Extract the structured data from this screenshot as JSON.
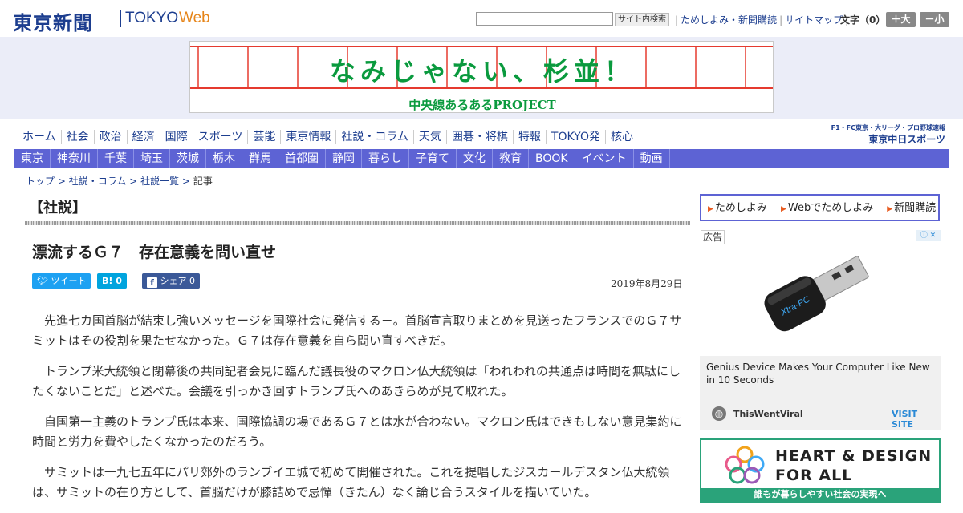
{
  "header": {
    "logo_main": "東京新聞",
    "logo_tokyo": "TOKYO",
    "logo_web": "Web",
    "search_button": "サイト内検索",
    "links": [
      "ためしよみ・新聞購読",
      "サイトマップ"
    ],
    "font_size_label": "文字（0）",
    "font_up": "＋大",
    "font_down": "－小"
  },
  "banner": {
    "headline": "なみじゃない、杉並！",
    "sub": "中央線あるあるPROJECT"
  },
  "nav_main": [
    "ホーム",
    "社会",
    "政治",
    "経済",
    "国際",
    "スポーツ",
    "芸能",
    "東京情報",
    "社説・コラム",
    "天気",
    "囲碁・将棋",
    "特報",
    "TOKYO発",
    "核心"
  ],
  "chunichi": {
    "line1": "F1・FC東京・大リーグ・プロ野球速報",
    "line2": "東京中日スポーツ"
  },
  "nav_sub": [
    "東京",
    "神奈川",
    "千葉",
    "埼玉",
    "茨城",
    "栃木",
    "群馬",
    "首都圏",
    "静岡",
    "暮らし",
    "子育て",
    "文化",
    "教育",
    "BOOK",
    "イベント",
    "動画"
  ],
  "breadcrumb": {
    "items": [
      "トップ",
      "社説・コラム",
      "社説一覧"
    ],
    "current": "記事",
    "sep": ">"
  },
  "article": {
    "section": "【社説】",
    "title": "漂流するＧ７　存在意義を問い直せ",
    "date": "2019年8月29日",
    "share": {
      "tweet": "ツイート",
      "hatena": "B! 0",
      "facebook": "シェア 0"
    },
    "paragraphs": [
      "先進七カ国首脳が結束し強いメッセージを国際社会に発信する－。首脳宣言取りまとめを見送ったフランスでのＧ７サミットはその役割を果たせなかった。Ｇ７は存在意義を自ら問い直すべきだ。",
      "トランプ米大統領と閉幕後の共同記者会見に臨んだ議長役のマクロン仏大統領は「われわれの共通点は時間を無駄にしたくないことだ」と述べた。会議を引っかき回すトランプ氏へのあきらめが見て取れた。",
      "自国第一主義のトランプ氏は本来、国際協調の場であるＧ７とは水が合わない。マクロン氏はできもしない意見集約に時間と労力を費やしたくなかったのだろう。",
      "サミットは一九七五年にパリ郊外のランブイエ城で初めて開催された。これを提唱したジスカールデスタン仏大統領は、サミットの在り方として、首脳だけが膝詰めで忌憚（きたん）なく論じ合うスタイルを描いていた。"
    ]
  },
  "sidebar": {
    "buttons": [
      "ためしよみ",
      "Webでためしよみ",
      "新聞購読"
    ],
    "ad_label": "広告",
    "usb_brand": "Xtra-PC",
    "ad_headline": "Genius Device Makes Your Computer Like New in 10 Seconds",
    "ad_source": "ThisWentViral",
    "ad_cta": "VISIT SITE",
    "heart_line1": "HEART & DESIGN",
    "heart_line2": "FOR ALL",
    "heart_bar": "誰もが暮らしやすい社会の実現へ"
  },
  "colors": {
    "brand": "#1d3e8f",
    "nav_sub_bg": "#5d63d4",
    "twitter": "#1da1f2",
    "hatena": "#00a4de",
    "facebook": "#3b5998",
    "banner_green": "#0a9a3e"
  }
}
